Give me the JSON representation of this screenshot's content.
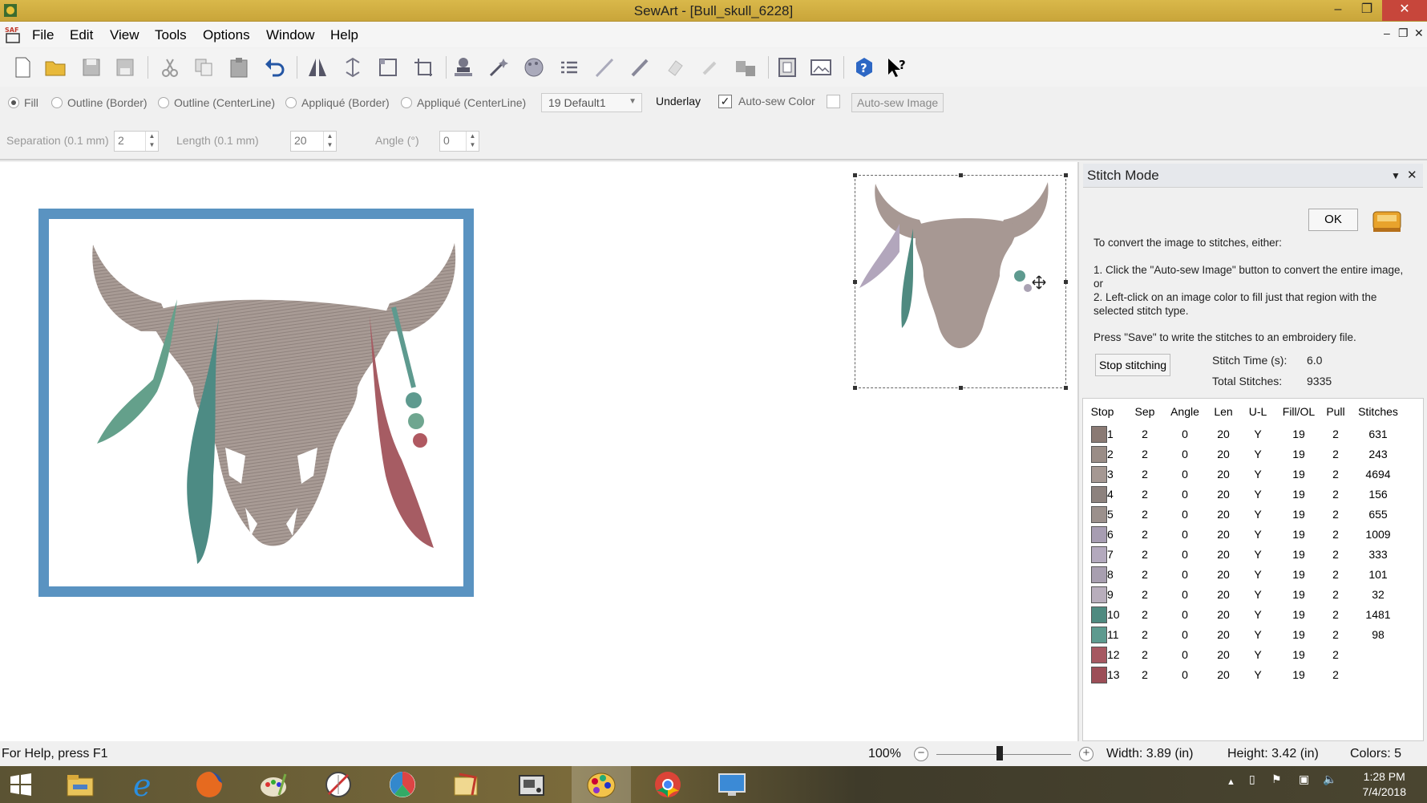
{
  "window": {
    "title": "SewArt - [Bull_skull_6228]",
    "minimize": "–",
    "maximize": "❐",
    "close": "✕"
  },
  "menu": {
    "items": [
      "File",
      "Edit",
      "View",
      "Tools",
      "Options",
      "Window",
      "Help"
    ],
    "mdi_min": "–",
    "mdi_restore": "❐",
    "mdi_close": "✕"
  },
  "toolbar": {
    "icons": [
      "new-file-icon",
      "open-folder-icon",
      "save-icon",
      "save-as-icon",
      "cut-icon",
      "copy-icon",
      "paste-icon",
      "undo-icon",
      "mirror-icon",
      "flip-icon",
      "crop-icon",
      "resize-icon",
      "stamp-icon",
      "wand-icon",
      "palette-icon",
      "lines-icon",
      "pen-icon",
      "pencil-icon",
      "eraser-icon",
      "brush-icon",
      "fill-icon",
      "frame-icon",
      "image-icon",
      "help-icon",
      "context-help-icon"
    ]
  },
  "options": {
    "fill": "Fill",
    "outline_border": "Outline (Border)",
    "outline_centerline": "Outline (CenterLine)",
    "applique_border": "Appliqué (Border)",
    "applique_centerline": "Appliqué (CenterLine)",
    "pattern": "19 Default1",
    "underlay": "Underlay",
    "auto_sew_color": "Auto-sew Color",
    "auto_sew_image": "Auto-sew Image"
  },
  "params": {
    "separation_label": "Separation (0.1 mm)",
    "separation_value": "2",
    "length_label": "Length (0.1 mm)",
    "length_value": "20",
    "angle_label": "Angle (°)",
    "angle_value": "0"
  },
  "panel": {
    "title": "Stitch Mode",
    "ok": "OK",
    "intro": "To convert the image to stitches, either:",
    "step1": "1. Click the \"Auto-sew Image\" button to convert the entire image, or",
    "step2": "2. Left-click on an image color to fill just that region with the selected stitch type.",
    "save_note": "Press \"Save\" to write the stitches to an embroidery file.",
    "stop_button": "Stop stitching",
    "stitch_time_label": "Stitch Time (s):",
    "stitch_time_value": "6.0",
    "total_stitches_label": "Total Stitches:",
    "total_stitches_value": "9335",
    "columns": [
      "Stop",
      "Sep",
      "Angle",
      "Len",
      "U-L",
      "Fill/OL",
      "Pull",
      "Stitches"
    ],
    "rows": [
      {
        "stop": "1",
        "sep": "2",
        "angle": "0",
        "len": "20",
        "ul": "Y",
        "fill": "19",
        "pull": "2",
        "stitches": "631",
        "color": "#8a7a74"
      },
      {
        "stop": "2",
        "sep": "2",
        "angle": "0",
        "len": "20",
        "ul": "Y",
        "fill": "19",
        "pull": "2",
        "stitches": "243",
        "color": "#9a8d87"
      },
      {
        "stop": "3",
        "sep": "2",
        "angle": "0",
        "len": "20",
        "ul": "Y",
        "fill": "19",
        "pull": "2",
        "stitches": "4694",
        "color": "#a59893"
      },
      {
        "stop": "4",
        "sep": "2",
        "angle": "0",
        "len": "20",
        "ul": "Y",
        "fill": "19",
        "pull": "2",
        "stitches": "156",
        "color": "#8d827e"
      },
      {
        "stop": "5",
        "sep": "2",
        "angle": "0",
        "len": "20",
        "ul": "Y",
        "fill": "19",
        "pull": "2",
        "stitches": "655",
        "color": "#9b908c"
      },
      {
        "stop": "6",
        "sep": "2",
        "angle": "0",
        "len": "20",
        "ul": "Y",
        "fill": "19",
        "pull": "2",
        "stitches": "1009",
        "color": "#a79db2"
      },
      {
        "stop": "7",
        "sep": "2",
        "angle": "0",
        "len": "20",
        "ul": "Y",
        "fill": "19",
        "pull": "2",
        "stitches": "333",
        "color": "#b3a9bd"
      },
      {
        "stop": "8",
        "sep": "2",
        "angle": "0",
        "len": "20",
        "ul": "Y",
        "fill": "19",
        "pull": "2",
        "stitches": "101",
        "color": "#a89fb0"
      },
      {
        "stop": "9",
        "sep": "2",
        "angle": "0",
        "len": "20",
        "ul": "Y",
        "fill": "19",
        "pull": "2",
        "stitches": "32",
        "color": "#b8aebc"
      },
      {
        "stop": "10",
        "sep": "2",
        "angle": "0",
        "len": "20",
        "ul": "Y",
        "fill": "19",
        "pull": "2",
        "stitches": "1481",
        "color": "#4f8a80"
      },
      {
        "stop": "11",
        "sep": "2",
        "angle": "0",
        "len": "20",
        "ul": "Y",
        "fill": "19",
        "pull": "2",
        "stitches": "98",
        "color": "#5e9a8f"
      },
      {
        "stop": "12",
        "sep": "2",
        "angle": "0",
        "len": "20",
        "ul": "Y",
        "fill": "19",
        "pull": "2",
        "stitches": "",
        "color": "#a65861"
      },
      {
        "stop": "13",
        "sep": "2",
        "angle": "0",
        "len": "20",
        "ul": "Y",
        "fill": "19",
        "pull": "2",
        "stitches": "",
        "color": "#9c4e57"
      }
    ]
  },
  "status": {
    "help": "For Help, press F1",
    "zoom": "100%",
    "zoom_level": 0.47,
    "width": "Width: 3.89 (in)",
    "height": "Height: 3.42 (in)",
    "colors": "Colors: 5"
  },
  "taskbar": {
    "apps": [
      "start-icon",
      "file-explorer-icon",
      "internet-explorer-icon",
      "firefox-icon",
      "paint-icon",
      "sewing-tool-icon",
      "photos-icon",
      "office-icon",
      "embroidery-machine-icon",
      "sewart-icon",
      "chrome-icon",
      "monitor-icon"
    ],
    "time": "1:28 PM",
    "date": "7/4/2018"
  }
}
